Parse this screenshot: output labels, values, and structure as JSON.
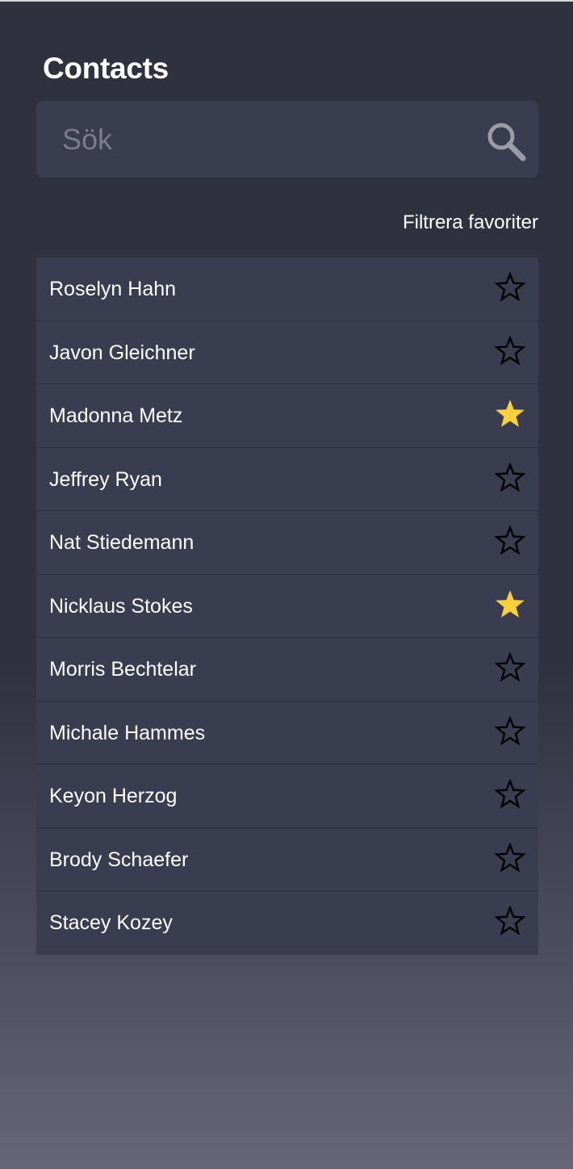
{
  "header": {
    "title": "Contacts"
  },
  "search": {
    "placeholder": "Sök",
    "value": "",
    "icon": "search-icon"
  },
  "filter": {
    "label": "Filtrera favoriter"
  },
  "colors": {
    "background_top": "#2f313f",
    "background_bottom": "#666579",
    "panel": "#3a3c50",
    "star_favorite": "#f9cf3f",
    "star_outline": "#000000"
  },
  "contacts": [
    {
      "name": "Roselyn Hahn",
      "favorite": false
    },
    {
      "name": "Javon Gleichner",
      "favorite": false
    },
    {
      "name": "Madonna Metz",
      "favorite": true
    },
    {
      "name": "Jeffrey Ryan",
      "favorite": false
    },
    {
      "name": "Nat Stiedemann",
      "favorite": false
    },
    {
      "name": "Nicklaus Stokes",
      "favorite": true
    },
    {
      "name": "Morris Bechtelar",
      "favorite": false
    },
    {
      "name": "Michale Hammes",
      "favorite": false
    },
    {
      "name": "Keyon Herzog",
      "favorite": false
    },
    {
      "name": "Brody Schaefer",
      "favorite": false
    },
    {
      "name": "Stacey Kozey",
      "favorite": false
    }
  ]
}
